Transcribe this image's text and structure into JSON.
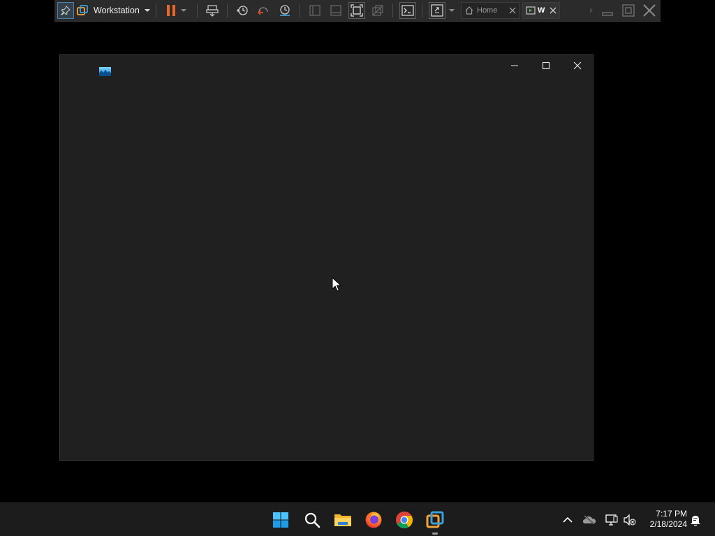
{
  "toolbar": {
    "product_label": "Workstation",
    "tabs": [
      {
        "label": "Home"
      },
      {
        "label": "W"
      }
    ]
  },
  "taskbar": {
    "clock": {
      "time": "7:17 PM",
      "date": "2/18/2024"
    }
  },
  "colors": {
    "desktop_bg": "#000000",
    "guest_window_bg": "#202020",
    "toolbar_bg": "#2b2b2b",
    "taskbar_bg": "#1c1c1c",
    "pause_accent": "#e8682b",
    "vmware_accent": "#3b9fd8"
  },
  "icons": {
    "toolbar": [
      "pin-icon",
      "vmware-logo-icon",
      "chevron-down-icon",
      "pause-icon",
      "send-keys-icon",
      "snapshot-icon",
      "revert-snapshot-icon",
      "snapshot-manager-icon",
      "library-icon",
      "thumbnail-icon",
      "fullscreen-icon",
      "unity-icon",
      "console-icon",
      "stretch-icon",
      "home-icon",
      "vm-tab-icon",
      "close-icon",
      "minimize-icon",
      "restore-icon"
    ],
    "taskbar": [
      "windows-start-icon",
      "search-icon",
      "file-explorer-icon",
      "firefox-icon",
      "chrome-icon",
      "vmware-icon",
      "chevron-up-icon",
      "onedrive-icon",
      "network-icon",
      "volume-muted-icon",
      "notification-bell-icon"
    ]
  }
}
